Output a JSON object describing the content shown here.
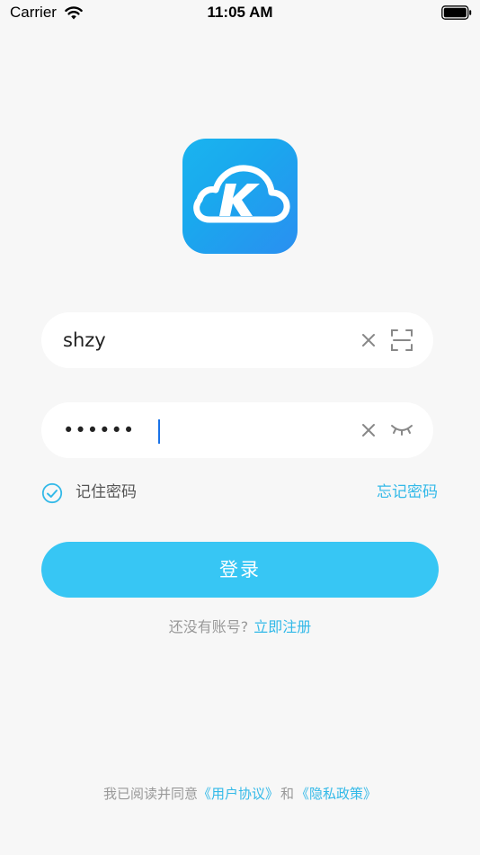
{
  "status_bar": {
    "carrier": "Carrier",
    "time": "11:05 AM",
    "wifi_icon": "wifi-icon",
    "battery_icon": "battery-full-icon"
  },
  "logo": {
    "icon": "cloud-k-logo",
    "letter": "K",
    "gradient_colors": [
      "#1ab4ef",
      "#2a8ff0"
    ]
  },
  "username_field": {
    "value": "shzy",
    "clear_icon": "close-icon",
    "scan_icon": "scan-icon"
  },
  "password_field": {
    "masked_value": "••••••",
    "clear_icon": "close-icon",
    "toggle_icon": "eye-closed-icon"
  },
  "remember": {
    "checked": true,
    "label": "记住密码",
    "icon": "check-circle-icon"
  },
  "forgot_password_label": "忘记密码",
  "login_button_label": "登录",
  "register": {
    "prompt": "还没有账号?",
    "link_label": "立即注册"
  },
  "agreement": {
    "prefix": "我已阅读并同意",
    "user_agreement": "《用户协议》",
    "and": "和",
    "privacy_policy": "《隐私政策》"
  },
  "colors": {
    "accent": "#33b9e8",
    "button": "#37c6f4",
    "background": "#f7f7f7"
  }
}
